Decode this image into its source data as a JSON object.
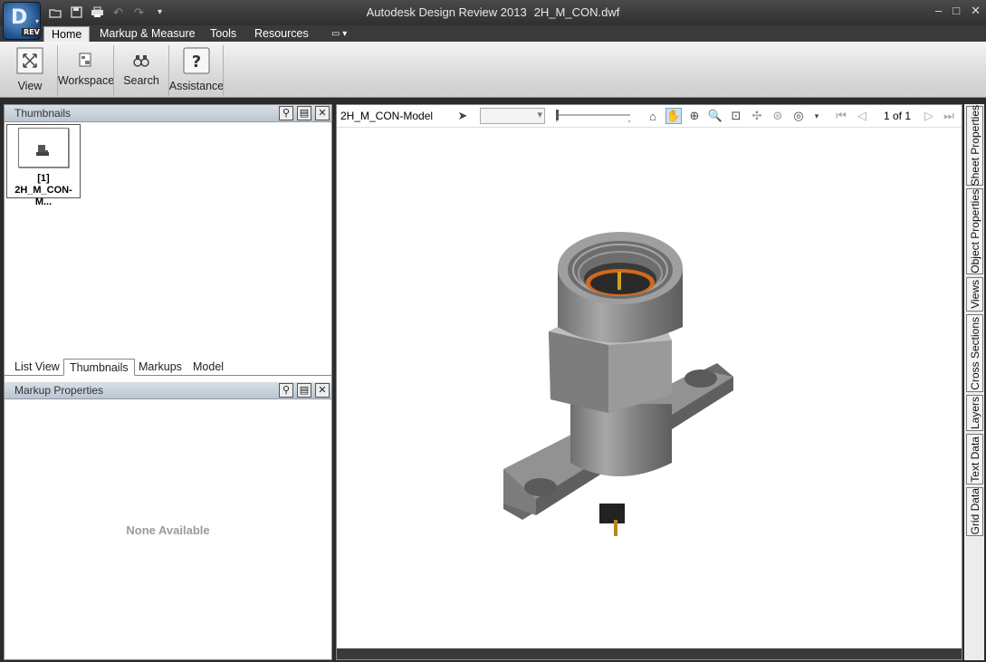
{
  "window": {
    "app_name": "Autodesk Design Review 2013",
    "file_name": "2H_M_CON.dwf",
    "app_badge": "REV"
  },
  "ribbon": {
    "tabs": [
      "Home",
      "Markup & Measure",
      "Tools",
      "Resources"
    ],
    "active_tab": "Home",
    "buttons": {
      "view": "View",
      "workspace": "Workspace",
      "search": "Search",
      "assistance": "Assistance"
    }
  },
  "left_panel": {
    "thumbnails_title": "Thumbnails",
    "thumbnail": {
      "index": "[1]",
      "label": "2H_M_CON-M..."
    },
    "tabs": [
      "List View",
      "Thumbnails",
      "Markups",
      "Model"
    ],
    "active_tab": "Thumbnails",
    "markup_title": "Markup Properties",
    "empty_text": "None Available"
  },
  "viewer": {
    "sheet_name": "2H_M_CON-Model",
    "page_indicator": "1 of 1"
  },
  "side_tabs": [
    "Sheet Properties",
    "Object Properties",
    "Views",
    "Cross Sections",
    "Layers",
    "Text Data",
    "Grid Data"
  ],
  "colors": {
    "titlebar": "#2f2f2f",
    "panel_header": "#c8d1da",
    "model_metal": "#8c8c8c",
    "model_gasket": "#d2691e"
  }
}
